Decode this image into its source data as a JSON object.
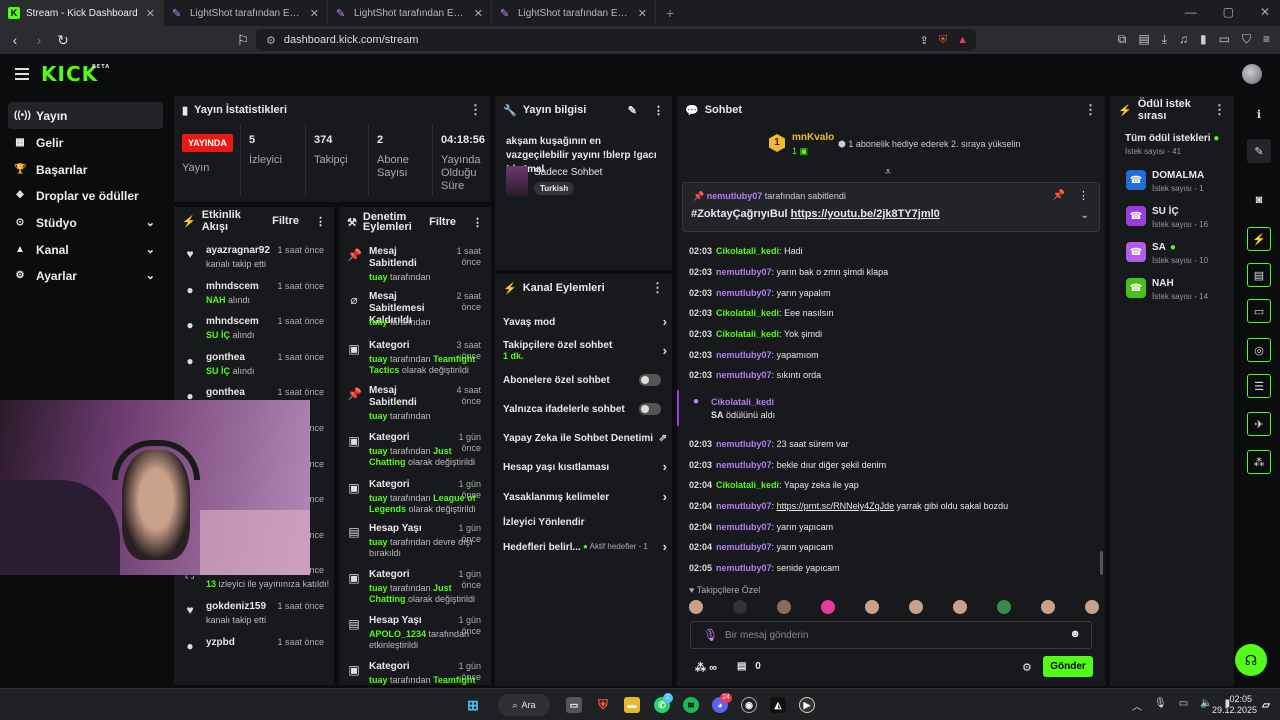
{
  "browser": {
    "tabs": [
      {
        "title": "Stream - Kick Dashboard",
        "active": true
      },
      {
        "title": "LightShot tarafından Ekran Görüntüsü",
        "active": false
      },
      {
        "title": "LightShot tarafından Ekran Görüntüsü",
        "active": false
      },
      {
        "title": "LightShot tarafından Ekran Görüntüsü",
        "active": false
      }
    ],
    "url": "dashboard.kick.com/stream"
  },
  "header": {
    "logo": "KICK",
    "beta": "BETA"
  },
  "sidebar": {
    "items": [
      {
        "icon": "((•))",
        "label": "Yayın",
        "active": true
      },
      {
        "icon": "▦",
        "label": "Gelir"
      },
      {
        "icon": "🏆",
        "label": "Başarılar"
      },
      {
        "icon": "❖",
        "label": "Droplar ve ödüller"
      },
      {
        "icon": "⊙",
        "label": "Stüdyo",
        "chevron": true
      },
      {
        "icon": "▲",
        "label": "Kanal",
        "chevron": true
      },
      {
        "icon": "⚙",
        "label": "Ayarlar",
        "chevron": true
      }
    ]
  },
  "stats": {
    "title": "Yayın İstatistikleri",
    "live_badge": "YAYINDA",
    "live_label": "Yayın",
    "cells": [
      {
        "value": "5",
        "label": "İzleyici"
      },
      {
        "value": "374",
        "label": "Takipçi"
      },
      {
        "value": "2",
        "label": "Abone Sayısı"
      },
      {
        "value": "04:18:56",
        "label": "Yayında Olduğu Süre"
      }
    ]
  },
  "events": {
    "title": "Etkinlik Akışı",
    "filter": "Filtre",
    "rows": [
      {
        "icon": "♥",
        "name": "ayazragnar92",
        "time": "1 saat önce",
        "sub": "kanalı takip etti",
        "hl": ""
      },
      {
        "icon": "●",
        "name": "mhndscem",
        "time": "1 saat önce",
        "hl": "NAH",
        "sub": "alındı"
      },
      {
        "icon": "●",
        "name": "mhndscem",
        "time": "1 saat önce",
        "hl": "SU İÇ",
        "sub": "alındı"
      },
      {
        "icon": "●",
        "name": "gonthea",
        "time": "1 saat önce",
        "hl": "SU İÇ",
        "sub": "alındı"
      },
      {
        "icon": "●",
        "name": "gonthea",
        "time": "1 saat önce",
        "hl": "",
        "sub": ""
      },
      {
        "icon": "●",
        "name": "",
        "time": "1 saat önce",
        "hl": "",
        "sub": ""
      },
      {
        "icon": "●",
        "name": "",
        "time": "1 saat önce",
        "hl": "",
        "sub": ""
      },
      {
        "icon": "●",
        "name": "",
        "time": "1 saat önce",
        "hl": "",
        "sub": ""
      },
      {
        "icon": "●",
        "name": "",
        "time": "1 saat önce",
        "hl": "SU İÇ",
        "sub": "alındı"
      },
      {
        "icon": "⛶",
        "name": "ISKORPIT",
        "time": "1 saat önce",
        "hl": "13",
        "sub": "izleyici ile yayınınıza katıldı!"
      },
      {
        "icon": "♥",
        "name": "gokdeniz159",
        "time": "1 saat önce",
        "hl": "",
        "sub": "kanalı takip etti"
      },
      {
        "icon": "●",
        "name": "yzpbd",
        "time": "1 saat önce",
        "hl": "",
        "sub": ""
      }
    ]
  },
  "mod": {
    "title": "Denetim Eylemleri",
    "filter": "Filtre",
    "rows": [
      {
        "icon": "📌",
        "title": "Mesaj Sabitlendi",
        "time": "1 saat önce",
        "who": "tuay",
        "mid": "tarafından",
        "hl": "",
        "tail": ""
      },
      {
        "icon": "⌀",
        "title": "Mesaj Sabitlemesi Kaldırıldı",
        "time": "2 saat önce",
        "who": "tuay",
        "mid": "tarafından",
        "hl": "",
        "tail": ""
      },
      {
        "icon": "▣",
        "title": "Kategori",
        "time": "3 saat önce",
        "who": "tuay",
        "mid": "tarafından",
        "hl": "Teamfight Tactics",
        "tail": "olarak değiştirildi"
      },
      {
        "icon": "📌",
        "title": "Mesaj Sabitlendi",
        "time": "4 saat önce",
        "who": "tuay",
        "mid": "tarafından",
        "hl": "",
        "tail": ""
      },
      {
        "icon": "▣",
        "title": "Kategori",
        "time": "1 gün önce",
        "who": "tuay",
        "mid": "tarafından",
        "hl": "Just Chatting",
        "tail": "olarak değiştirildi"
      },
      {
        "icon": "▣",
        "title": "Kategori",
        "time": "1 gün önce",
        "who": "tuay",
        "mid": "tarafından",
        "hl": "League of Legends",
        "tail": "olarak değiştirildi"
      },
      {
        "icon": "▤",
        "title": "Hesap Yaşı",
        "time": "1 gün önce",
        "who": "tuay",
        "mid": "tarafından devre dışı bırakıldı",
        "hl": "",
        "tail": ""
      },
      {
        "icon": "▣",
        "title": "Kategori",
        "time": "1 gün önce",
        "who": "tuay",
        "mid": "tarafından",
        "hl": "Just Chatting",
        "tail": "olarak değiştirildi"
      },
      {
        "icon": "▤",
        "title": "Hesap Yaşı",
        "time": "1 gün önce",
        "who": "APOLO_1234",
        "mid": "tarafından etkinleştirildi",
        "hl": "",
        "tail": ""
      },
      {
        "icon": "▣",
        "title": "Kategori",
        "time": "1 gün önce",
        "who": "tuay",
        "mid": "tarafından",
        "hl": "Teamfight",
        "tail": ""
      }
    ]
  },
  "info": {
    "title": "Yayın bilgisi",
    "stream_title": "akşam kuşağının en vazgeçilebilir yayını !blerp !gacı !dc !mal",
    "category": "Sadece Sohbet",
    "tag": "Turkish"
  },
  "channel": {
    "title": "Kanal Eylemleri",
    "rows": [
      {
        "label": "Yavaş mod",
        "ctl": "arrow"
      },
      {
        "label": "Takipçilere özel sohbet",
        "sub": "1 dk.",
        "ctl": "arrow"
      },
      {
        "label": "Abonelere özel sohbet",
        "ctl": "toggle"
      },
      {
        "label": "Yalnızca ifadelerle sohbet",
        "ctl": "toggle"
      },
      {
        "label": "Yapay Zeka ile Sohbet Denetimi",
        "ctl": "ext"
      },
      {
        "label": "Hesap yaşı kısıtlaması",
        "ctl": "arrow"
      },
      {
        "label": "Yasaklanmış kelimeler",
        "ctl": "arrow"
      },
      {
        "label": "İzleyici Yönlendir",
        "ctl": ""
      },
      {
        "label": "Hedefleri belirl...",
        "extra": "Aktif hedefler - 1",
        "ctl": "arrow"
      }
    ]
  },
  "chat": {
    "title": "Sohbet",
    "top_rank": "1",
    "top_user": "mnKvalo",
    "top_count": "1",
    "gift_text": "1 abonelik hediye ederek 2. sıraya yükselin",
    "pinned_by": "nemutluby07",
    "pinned_suffix": "tarafından sabitlendi",
    "pinned_msg": "#ZoktayÇağrıyıBul",
    "pinned_link": "https://youtu.be/2jk8TY7jml0",
    "messages": [
      {
        "time": "02:03",
        "user": "Cikolatali_kedi",
        "color": "g",
        "text": "Hadi"
      },
      {
        "time": "02:03",
        "user": "nemutluby07",
        "color": "p",
        "text": "yarın bak o zmn şimdi klapa"
      },
      {
        "time": "02:03",
        "user": "nemutluby07",
        "color": "p",
        "text": "yarın yapalım"
      },
      {
        "time": "02:03",
        "user": "Cikolatali_kedi",
        "color": "g",
        "text": "Eee nasılsın"
      },
      {
        "time": "02:03",
        "user": "Cikolatali_kedi",
        "color": "g",
        "text": "Yok şimdi"
      },
      {
        "time": "02:03",
        "user": "nemutluby07",
        "color": "p",
        "text": "yapamıom"
      },
      {
        "time": "02:03",
        "user": "nemutluby07",
        "color": "p",
        "text": "sıkıntı orda"
      },
      {
        "time": "02:03",
        "user": "nemutluby07",
        "color": "p",
        "text": "23 saat sürem var"
      },
      {
        "time": "02:03",
        "user": "nemutluby07",
        "color": "p",
        "text": "bekle dıur diğer şekil denim"
      },
      {
        "time": "02:04",
        "user": "Cikolatali_kedi",
        "color": "g",
        "text": "Yapay zeka ile yap"
      },
      {
        "time": "02:04",
        "user": "nemutluby07",
        "color": "p",
        "link": "https://prnt.sc/RNNely4ZqJde",
        "text": "yarrak gibi oldu sakal bozdu"
      },
      {
        "time": "02:04",
        "user": "nemutluby07",
        "color": "p",
        "text": "yarın yapıcam"
      },
      {
        "time": "02:04",
        "user": "nemutluby07",
        "color": "p",
        "text": "yarın yapıcam"
      },
      {
        "time": "02:05",
        "user": "nemutluby07",
        "color": "p",
        "text": "senide yapıcam"
      }
    ],
    "reward_user": "Cikolatali_kedi",
    "reward_name": "SA",
    "reward_suffix": "ödülünü aldı",
    "followers_label": "Takipçilere Özel",
    "input_placeholder": "Bir mesaj gönderin",
    "points": "∞",
    "box_count": "0",
    "send_label": "Gönder"
  },
  "rewards": {
    "title": "Ödül istek sırası",
    "all_label": "Tüm ödül istekleri",
    "all_count": "İstek sayısı - 41",
    "items": [
      {
        "name": "DOMALMA",
        "count": "İstek sayısı - 1",
        "color": "#1e6fd9",
        "dot": false
      },
      {
        "name": "SU İÇ",
        "count": "İstek sayısı - 16",
        "color": "#9b3ee0",
        "dot": false
      },
      {
        "name": "SA",
        "count": "İstek sayısı - 10",
        "color": "#b05ee8",
        "dot": true
      },
      {
        "name": "NAH",
        "count": "İstek sayısı - 14",
        "color": "#48c21a",
        "dot": false
      }
    ]
  },
  "taskbar": {
    "search": "Ara",
    "time": "02:05",
    "date": "29.12.2025",
    "badge_whatsapp": "2",
    "badge_discord": "24"
  },
  "colors": {
    "accent": "#53fc18",
    "live": "#e91916",
    "panel": "#18191c",
    "bg": "#0b0c0e"
  }
}
